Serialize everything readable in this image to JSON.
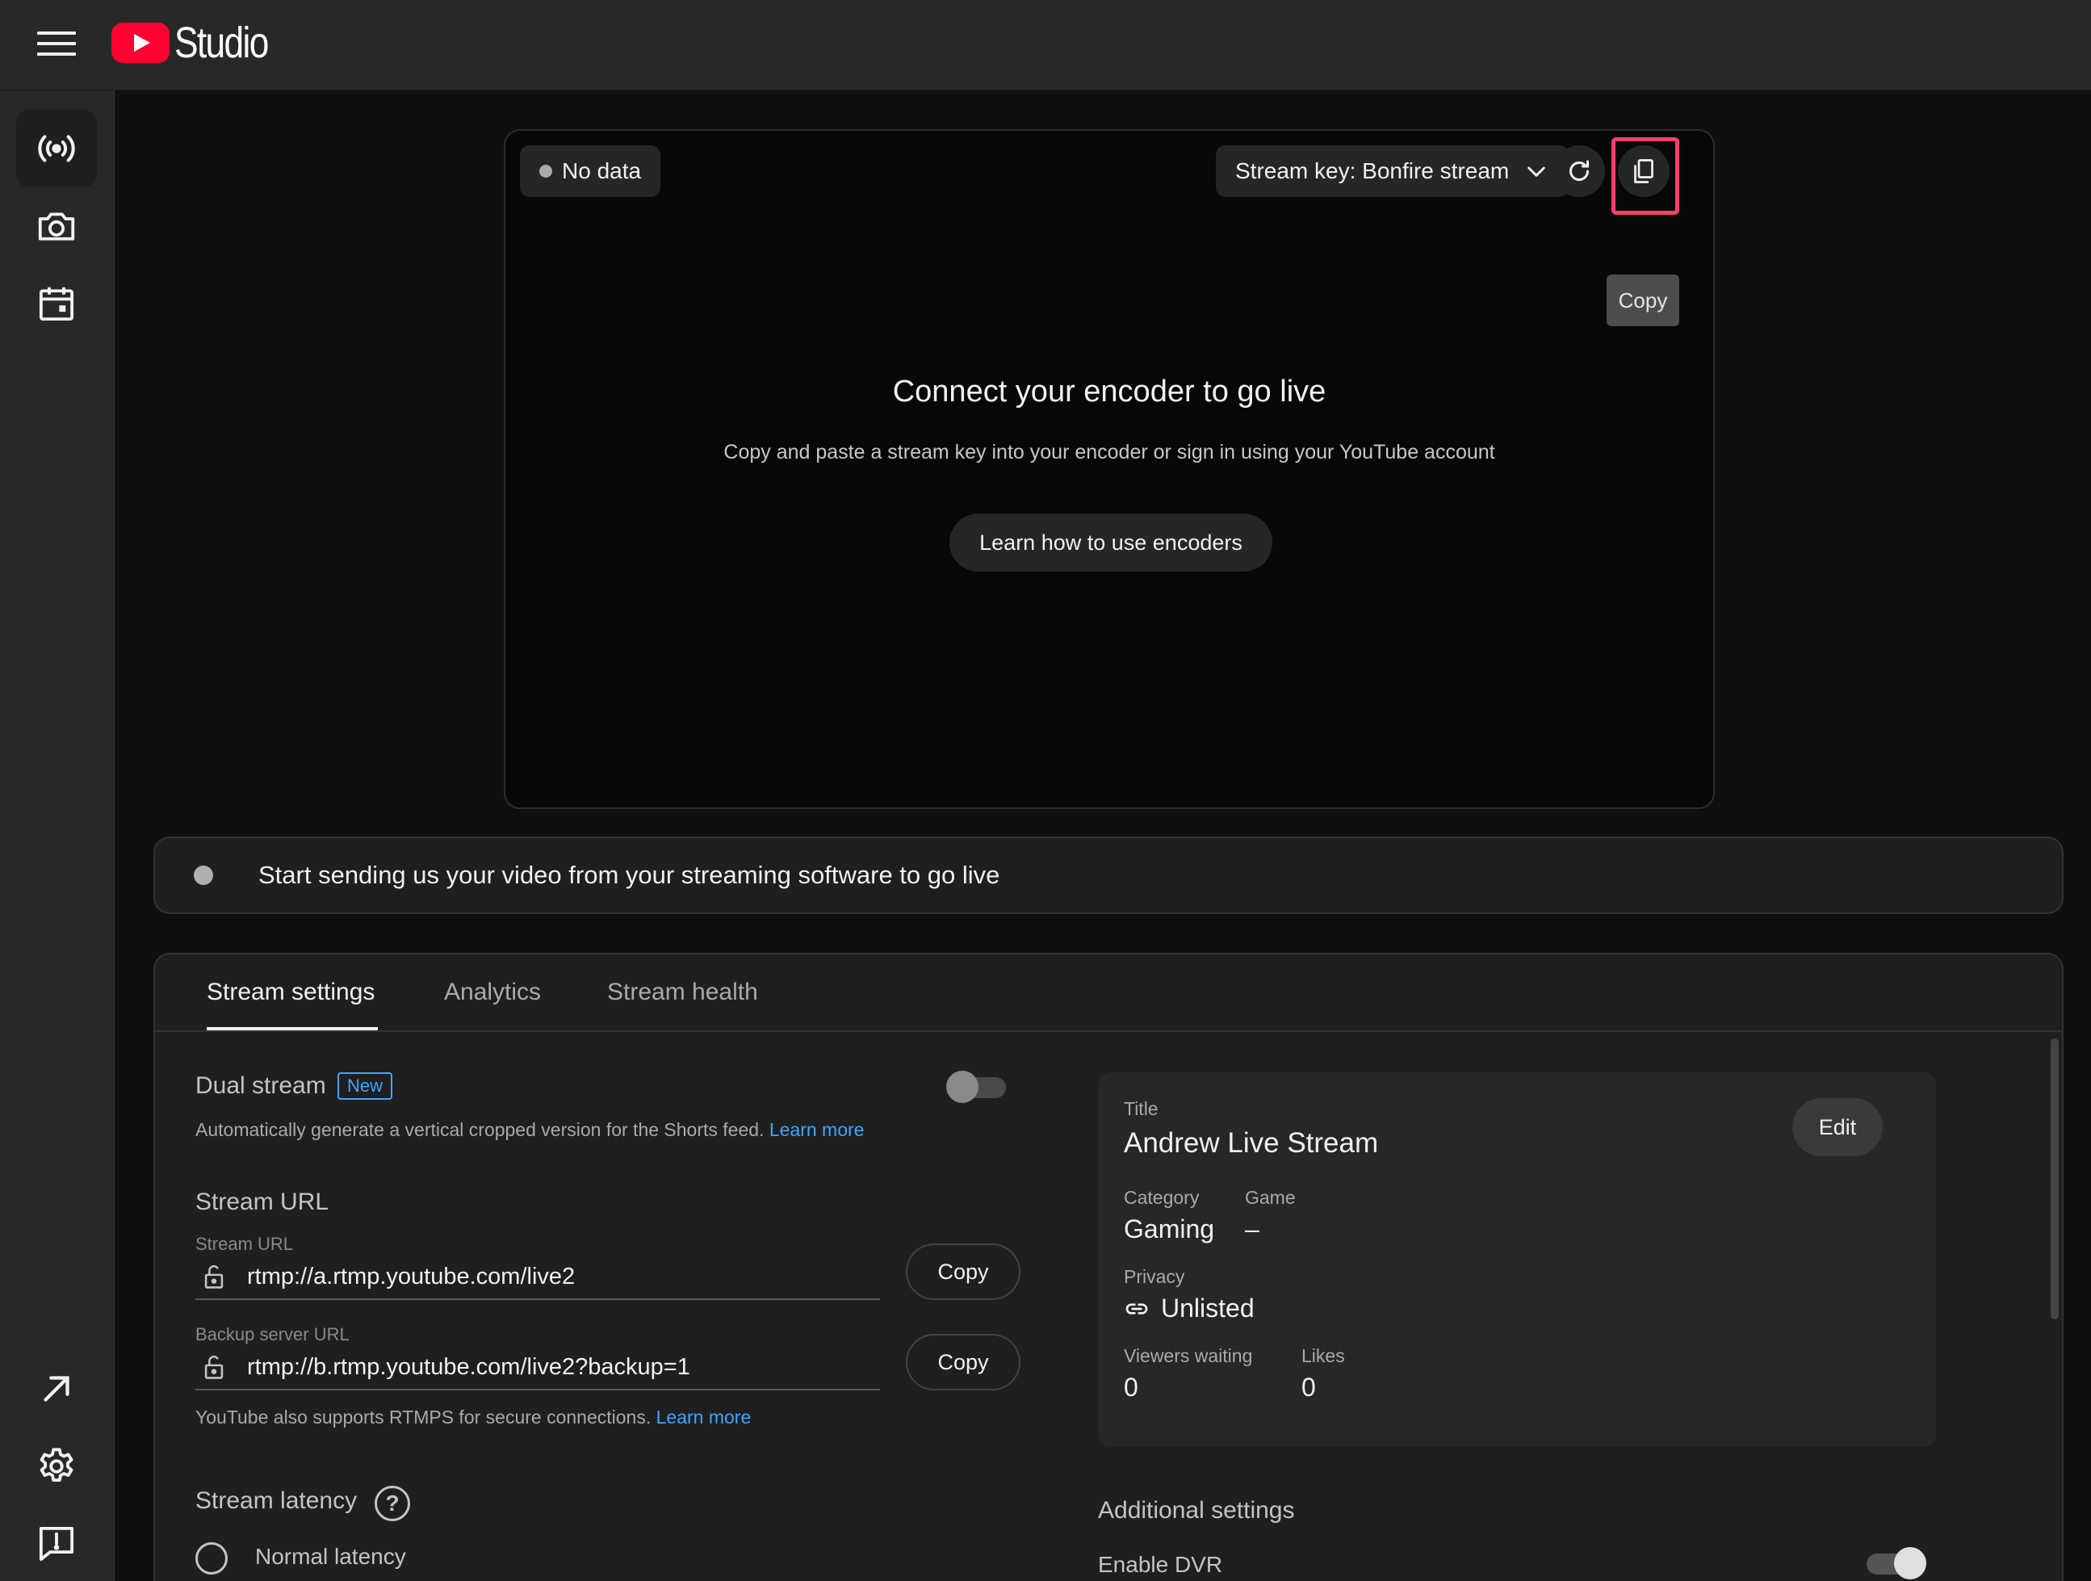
{
  "app": {
    "name": "Studio"
  },
  "preview": {
    "status_badge": "No data",
    "stream_key_label": "Stream key: Bonfire stream",
    "tooltip": "Copy",
    "title": "Connect your encoder to go live",
    "subtitle": "Copy and paste a stream key into your encoder or sign in using your YouTube account",
    "learn_button": "Learn how to use encoders"
  },
  "status_bar": {
    "text": "Start sending us your video from your streaming software to go live"
  },
  "tabs": [
    {
      "label": "Stream settings",
      "active": true
    },
    {
      "label": "Analytics",
      "active": false
    },
    {
      "label": "Stream health",
      "active": false
    }
  ],
  "dual_stream": {
    "label": "Dual stream",
    "badge": "New",
    "description": "Automatically generate a vertical cropped version for the Shorts feed.",
    "learn_more": "Learn more",
    "enabled": false
  },
  "stream_url": {
    "section_title": "Stream URL",
    "url_label": "Stream URL",
    "url_value": "rtmp://a.rtmp.youtube.com/live2",
    "backup_label": "Backup server URL",
    "backup_value": "rtmp://b.rtmp.youtube.com/live2?backup=1",
    "copy_label": "Copy",
    "rtmps_note": "YouTube also supports RTMPS for secure connections.",
    "learn_more": "Learn more"
  },
  "stream_latency": {
    "title": "Stream latency",
    "first_option_partial": "Normal latency"
  },
  "info": {
    "title_label": "Title",
    "title_value": "Andrew Live Stream",
    "edit_label": "Edit",
    "category_label": "Category",
    "category_value": "Gaming",
    "game_label": "Game",
    "game_value": "–",
    "privacy_label": "Privacy",
    "privacy_value": "Unlisted",
    "viewers_label": "Viewers waiting",
    "viewers_value": "0",
    "likes_label": "Likes",
    "likes_value": "0"
  },
  "additional": {
    "title": "Additional settings",
    "first_option_partial": "Enable DVR"
  },
  "colors": {
    "accent_red": "#ff0033",
    "link_blue": "#3ea6ff",
    "highlight": "#ff3e6c"
  }
}
